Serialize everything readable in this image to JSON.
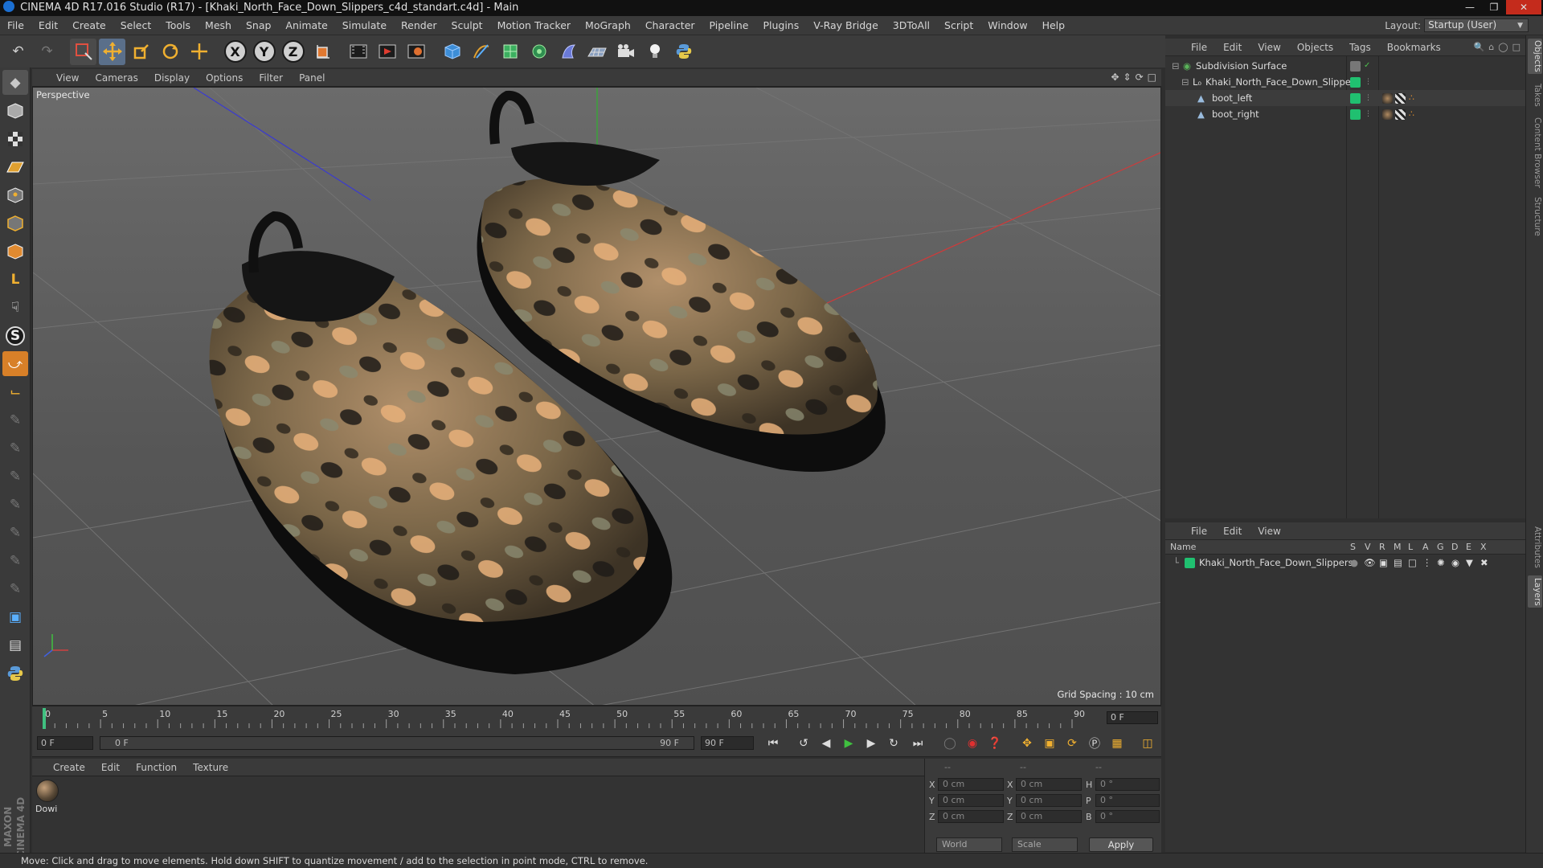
{
  "window": {
    "title": "CINEMA 4D R17.016 Studio (R17) - [Khaki_North_Face_Down_Slippers_c4d_standart.c4d] - Main"
  },
  "menu": [
    "File",
    "Edit",
    "Create",
    "Select",
    "Tools",
    "Mesh",
    "Snap",
    "Animate",
    "Simulate",
    "Render",
    "Sculpt",
    "Motion Tracker",
    "MoGraph",
    "Character",
    "Pipeline",
    "Plugins",
    "V-Ray Bridge",
    "3DToAll",
    "Script",
    "Window",
    "Help"
  ],
  "layout": {
    "label": "Layout:",
    "value": "Startup (User)"
  },
  "toolbar_icons": [
    "undo-icon",
    "redo-icon",
    "live-selection-icon",
    "move-icon",
    "scale-icon",
    "rotate-icon",
    "transform-icon",
    "x-axis-icon",
    "y-axis-icon",
    "z-axis-icon",
    "coordinate-system-icon",
    "render-view-icon",
    "render-picture-viewer-icon",
    "edit-render-settings-icon",
    "cube-icon",
    "pen-icon",
    "subdivision-icon",
    "array-icon",
    "deformer-icon",
    "floor-icon",
    "camera-icon",
    "light-icon",
    "python-icon"
  ],
  "axis_labels": {
    "x": "X",
    "y": "Y",
    "z": "Z"
  },
  "viewport": {
    "menu": [
      "View",
      "Cameras",
      "Display",
      "Options",
      "Filter",
      "Panel"
    ],
    "label": "Perspective",
    "grid_spacing": "Grid Spacing : 10 cm"
  },
  "timeline": {
    "ticks": [
      "0",
      "5",
      "10",
      "15",
      "20",
      "25",
      "30",
      "35",
      "40",
      "45",
      "50",
      "55",
      "60",
      "65",
      "70",
      "75",
      "80",
      "85",
      "90"
    ],
    "current_frame": "0 F"
  },
  "playback": {
    "start": "0 F",
    "range_start": "0 F",
    "range_end": "90 F",
    "end": "90 F"
  },
  "material_manager": {
    "menu": [
      "Create",
      "Edit",
      "Function",
      "Texture"
    ],
    "material_name": "Dowi"
  },
  "coordinates": {
    "header": [
      "--",
      "--",
      "--"
    ],
    "rows": [
      {
        "axis": "X",
        "pos": "0 cm",
        "size_axis": "X",
        "size": "0 cm",
        "rot_axis": "H",
        "rot": "0 °"
      },
      {
        "axis": "Y",
        "pos": "0 cm",
        "size_axis": "Y",
        "size": "0 cm",
        "rot_axis": "P",
        "rot": "0 °"
      },
      {
        "axis": "Z",
        "pos": "0 cm",
        "size_axis": "Z",
        "size": "0 cm",
        "rot_axis": "B",
        "rot": "0 °"
      }
    ],
    "mode": "World",
    "transform": "Scale",
    "apply": "Apply"
  },
  "status": "Move: Click and drag to move elements. Hold down SHIFT to quantize movement / add to the selection in point mode, CTRL to remove.",
  "object_manager": {
    "menu": [
      "File",
      "Edit",
      "View",
      "Objects",
      "Tags",
      "Bookmarks"
    ],
    "objects": [
      {
        "name": "Subdivision Surface",
        "indent": 0,
        "color": "#4fa84f"
      },
      {
        "name": "Khaki_North_Face_Down_Slippers",
        "indent": 1,
        "color": "#20c070"
      },
      {
        "name": "boot_left",
        "indent": 2,
        "color": "#20c070"
      },
      {
        "name": "boot_right",
        "indent": 2,
        "color": "#20c070"
      }
    ]
  },
  "layer_manager": {
    "menu": [
      "File",
      "Edit",
      "View"
    ],
    "columns": [
      "Name",
      "S",
      "V",
      "R",
      "M",
      "L",
      "A",
      "G",
      "D",
      "E",
      "X"
    ],
    "layers": [
      {
        "name": "Khaki_North_Face_Down_Slippers",
        "color": "#20c070"
      }
    ]
  },
  "side_tabs": [
    "Objects",
    "Takes",
    "Content Browser",
    "Structure",
    "Attributes",
    "Layers"
  ],
  "brand": "MAXON CINEMA 4D",
  "colors": {
    "accent": "#3b7fd0",
    "layer_green": "#20c070",
    "close": "#c42b1c"
  }
}
